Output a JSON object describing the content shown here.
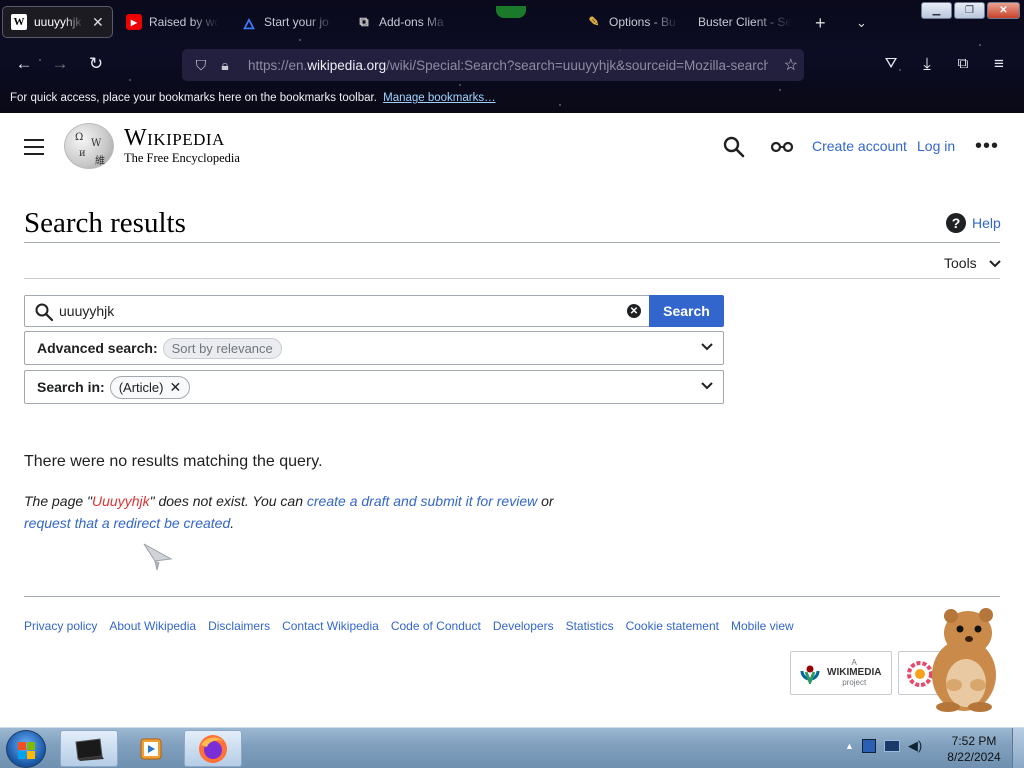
{
  "browser": {
    "tabs": [
      {
        "title": "uuuyyhjk",
        "favicon": "W",
        "active": true
      },
      {
        "title": "Raised by wo",
        "favicon": "youtube-icon"
      },
      {
        "title": "Start your jo",
        "favicon": "flame-icon"
      },
      {
        "title": "Add-ons Ma",
        "favicon": "puzzle-icon"
      },
      {
        "title": "Options - Bu",
        "favicon": "options-icon"
      },
      {
        "title": "Buster Client - Se",
        "favicon": ""
      }
    ],
    "url_prefix": "https://en.",
    "url_domain": "wikipedia.org",
    "url_path": "/wiki/Special:Search?search=uuuyyhjk&sourceid=Mozilla-search",
    "bookmarks_message": "For quick access, place your bookmarks here on the bookmarks toolbar.",
    "manage_bookmarks": "Manage bookmarks…"
  },
  "header": {
    "wordmark": "Wikipedia",
    "tagline": "The Free Encyclopedia",
    "create_account": "Create account",
    "log_in": "Log in"
  },
  "main": {
    "title": "Search results",
    "help": "Help",
    "tools": "Tools",
    "search_value": "uuuyyhjk",
    "search_button": "Search",
    "advanced_label": "Advanced search:",
    "advanced_chip": "Sort by relevance",
    "search_in_label": "Search in:",
    "search_in_chip": "(Article)",
    "no_results": "There were no results matching the query.",
    "notice": {
      "p1": "The page \"",
      "page": "Uuuyyhjk",
      "p2": "\" does not exist. You can ",
      "link1": "create a draft and submit it for review",
      "p3": " or",
      "link2": "request that a redirect be created",
      "p4": "."
    }
  },
  "footer": {
    "links": [
      "Privacy policy",
      "About Wikipedia",
      "Disclaimers",
      "Contact Wikipedia",
      "Code of Conduct",
      "Developers",
      "Statistics",
      "Cookie statement",
      "Mobile view"
    ],
    "wikimedia_badge": "WIKIMEDIA",
    "wikimedia_sub": "project"
  },
  "taskbar": {
    "time": "7:52 PM",
    "date": "8/22/2024"
  },
  "colors": {
    "link": "#3366cc",
    "redlink": "#dd3333",
    "search_button": "#3366cc"
  }
}
